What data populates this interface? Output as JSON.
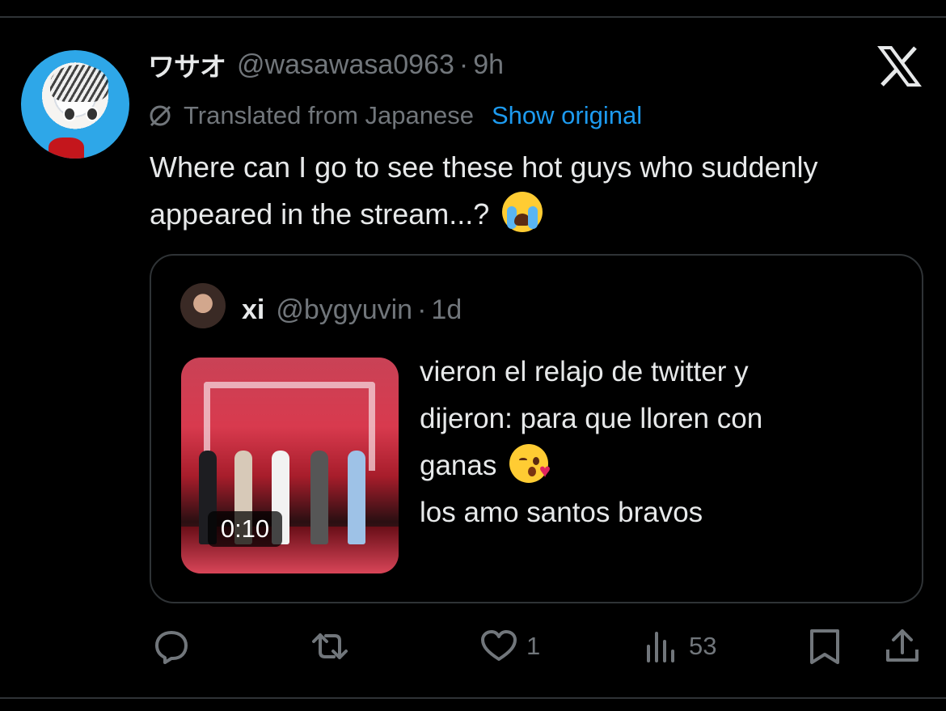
{
  "tweet": {
    "author_name": "ワサオ",
    "author_handle": "@wasawasa0963",
    "separator": "·",
    "time": "9h",
    "translation_note": "Translated from Japanese",
    "show_original": "Show original",
    "text": "Where can I go to see these hot guys who suddenly appeared in the stream...?"
  },
  "quoted_tweet": {
    "author_name": "xi",
    "author_handle": "@bygyuvin",
    "separator": "·",
    "time": "1d",
    "video_duration": "0:10",
    "line1": "vieron el relajo de twitter y",
    "line2": "dijeron: para que lloren con",
    "line3": "ganas",
    "line4": "los amo santos bravos"
  },
  "actions": {
    "reply": {
      "icon": "reply-icon",
      "count": ""
    },
    "retweet": {
      "icon": "retweet-icon",
      "count": ""
    },
    "like": {
      "icon": "heart-icon",
      "count": "1"
    },
    "views": {
      "icon": "views-icon",
      "count": "53"
    },
    "bookmark": {
      "icon": "bookmark-icon",
      "count": ""
    },
    "share": {
      "icon": "share-icon",
      "count": ""
    }
  },
  "colors": {
    "background": "#000000",
    "text": "#e7e9ea",
    "muted": "#71767b",
    "link": "#1d9bf0",
    "border": "#2f3336"
  }
}
